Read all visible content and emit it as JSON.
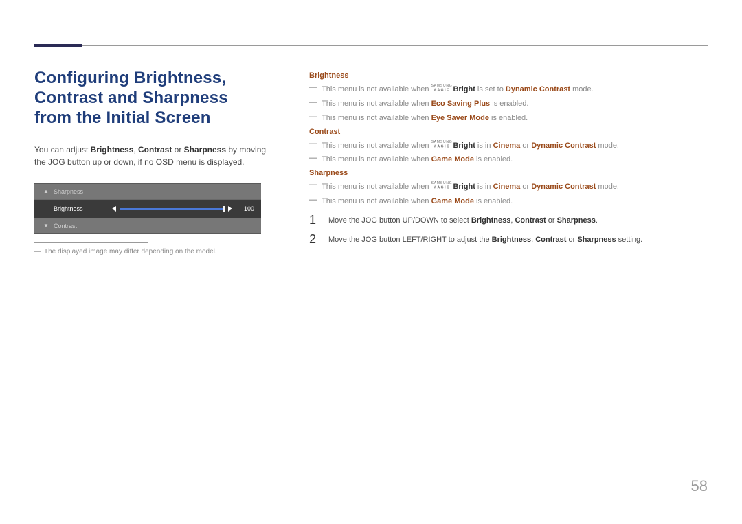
{
  "page_number": "58",
  "title": "Configuring Brightness, Contrast and Sharpness from the Initial Screen",
  "intro": {
    "pre": "You can adjust ",
    "b1": "Brightness",
    "sep1": ", ",
    "b2": "Contrast",
    "sep2": " or ",
    "b3": "Sharpness",
    "post": " by moving the JOG button up or down, if no OSD menu is displayed."
  },
  "osd": {
    "up_label": "Sharpness",
    "active_label": "Brightness",
    "value": "100",
    "down_label": "Contrast"
  },
  "footnote": "The displayed image may differ depending on the model.",
  "right": {
    "sections": [
      {
        "head": "Brightness",
        "items": [
          {
            "pre": "This menu is not available when ",
            "magic": true,
            "mid": "Bright",
            "post": " is set to ",
            "o1": "Dynamic Contrast",
            "tail": " mode."
          },
          {
            "pre": "This menu is not available when ",
            "o1": "Eco Saving Plus",
            "tail": " is enabled."
          },
          {
            "pre": "This menu is not available when ",
            "o1": "Eye Saver Mode",
            "tail": " is enabled."
          }
        ]
      },
      {
        "head": "Contrast",
        "items": [
          {
            "pre": "This menu is not available when ",
            "magic": true,
            "mid": "Bright",
            "post": " is in ",
            "o1": "Cinema",
            "sep": " or ",
            "o2": "Dynamic Contrast",
            "tail": " mode."
          },
          {
            "pre": "This menu is not available when ",
            "o1": "Game Mode",
            "tail": " is enabled."
          }
        ]
      },
      {
        "head": "Sharpness",
        "items": [
          {
            "pre": "This menu is not available when ",
            "magic": true,
            "mid": "Bright",
            "post": " is in ",
            "o1": "Cinema",
            "sep": " or ",
            "o2": "Dynamic Contrast",
            "tail": " mode."
          },
          {
            "pre": "This menu is not available when ",
            "o1": "Game Mode",
            "tail": " is enabled."
          }
        ]
      }
    ]
  },
  "steps": [
    {
      "num": "1",
      "pre": "Move the JOG button UP/DOWN to select ",
      "b1": "Brightness",
      "s1": ", ",
      "b2": "Contrast",
      "s2": " or ",
      "b3": "Sharpness",
      "post": "."
    },
    {
      "num": "2",
      "pre": "Move the JOG button LEFT/RIGHT to adjust the ",
      "b1": "Brightness",
      "s1": ", ",
      "b2": "Contrast",
      "s2": " or ",
      "b3": "Sharpness",
      "post": " setting."
    }
  ],
  "magic_top": "SAMSUNG",
  "magic_bot": "MAGIC"
}
